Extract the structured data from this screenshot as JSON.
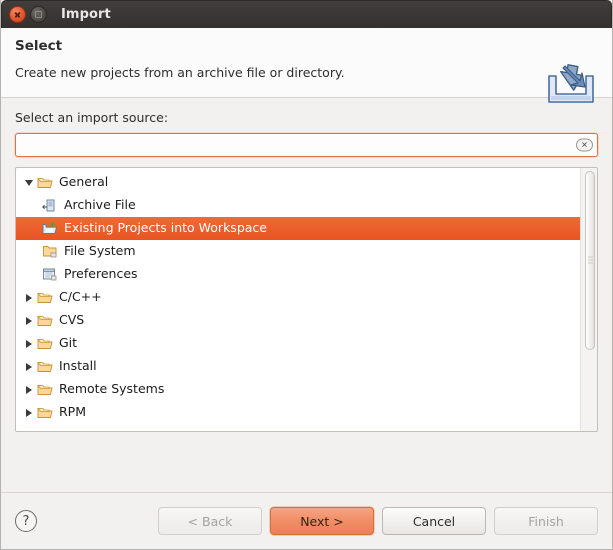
{
  "window": {
    "title": "Import",
    "controls": [
      {
        "name": "close",
        "icon": "close-icon"
      },
      {
        "name": "restore",
        "icon": "restore-icon"
      }
    ]
  },
  "header": {
    "title": "Select",
    "description": "Create new projects from an archive file or directory.",
    "icon": "import-wizard-icon"
  },
  "source": {
    "label": "Select an import source:",
    "value": "",
    "placeholder": "",
    "clear_icon": "clear-icon"
  },
  "tree": {
    "items": [
      {
        "label": "General",
        "level": 0,
        "expanded": true,
        "icon": "folder-open-icon",
        "selected": false
      },
      {
        "label": "Archive File",
        "level": 1,
        "expanded": null,
        "icon": "archive-file-icon",
        "selected": false
      },
      {
        "label": "Existing Projects into Workspace",
        "level": 1,
        "expanded": null,
        "icon": "existing-projects-icon",
        "selected": true
      },
      {
        "label": "File System",
        "level": 1,
        "expanded": null,
        "icon": "file-system-icon",
        "selected": false
      },
      {
        "label": "Preferences",
        "level": 1,
        "expanded": null,
        "icon": "preferences-icon",
        "selected": false
      },
      {
        "label": "C/C++",
        "level": 0,
        "expanded": false,
        "icon": "folder-open-icon",
        "selected": false
      },
      {
        "label": "CVS",
        "level": 0,
        "expanded": false,
        "icon": "folder-open-icon",
        "selected": false
      },
      {
        "label": "Git",
        "level": 0,
        "expanded": false,
        "icon": "folder-open-icon",
        "selected": false
      },
      {
        "label": "Install",
        "level": 0,
        "expanded": false,
        "icon": "folder-open-icon",
        "selected": false
      },
      {
        "label": "Remote Systems",
        "level": 0,
        "expanded": false,
        "icon": "folder-open-icon",
        "selected": false
      },
      {
        "label": "RPM",
        "level": 0,
        "expanded": false,
        "icon": "folder-open-icon",
        "selected": false
      }
    ],
    "selection_color": "#ec5f2c",
    "scrollbar": {
      "visible": true,
      "thumb_top_pct": 1,
      "thumb_height_pct": 68
    }
  },
  "footer": {
    "help_label": "?",
    "buttons": [
      {
        "label": "< Back",
        "state": "disabled",
        "name": "back-button"
      },
      {
        "label": "Next >",
        "state": "primary",
        "name": "next-button"
      },
      {
        "label": "Cancel",
        "state": "enabled",
        "name": "cancel-button"
      },
      {
        "label": "Finish",
        "state": "disabled",
        "name": "finish-button"
      }
    ]
  },
  "colors": {
    "accent": "#ec5f2c",
    "focus_border": "#e0743a",
    "titlebar": "#3a3735",
    "panel": "#f2f1f0"
  }
}
